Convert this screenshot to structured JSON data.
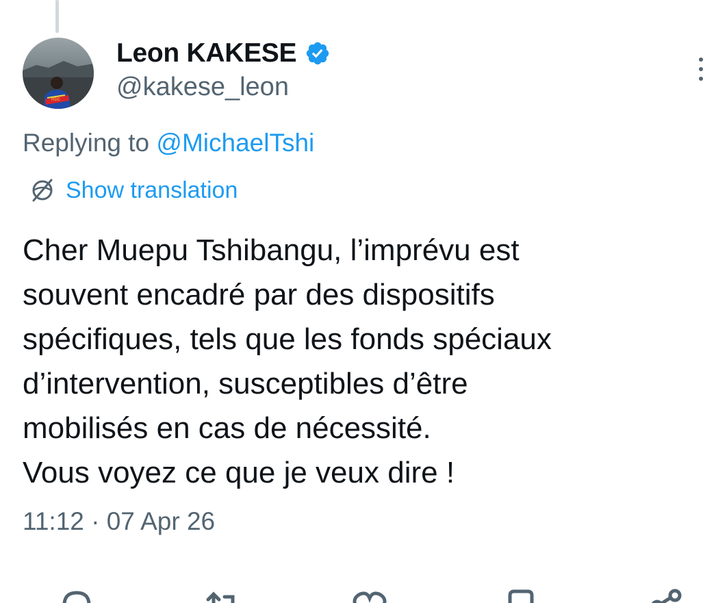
{
  "tweet": {
    "author": {
      "display_name": "Leon KAKESE",
      "handle": "@kakese_leon",
      "verified": true,
      "avatar_icon": "profile-photo-avatar"
    },
    "reply": {
      "prefix": "Replying to ",
      "mention": "@MichaelTshi"
    },
    "translation": {
      "label": "Show translation",
      "icon": "globe-icon"
    },
    "text": "Cher Muepu Tshibangu, l’imprévu est\nsouvent encadré par des dispositifs\nspécifiques, tels que les fonds spéciaux\nd’intervention, susceptibles d’être\nmobilisés en cas de nécessité.\nVous voyez ce que je veux dire !",
    "timestamp": "11:12 · 07 Apr 26"
  },
  "actions": [
    {
      "name": "reply",
      "icon": "reply-icon"
    },
    {
      "name": "retweet",
      "icon": "retweet-icon"
    },
    {
      "name": "like",
      "icon": "heart-icon"
    },
    {
      "name": "bookmark",
      "icon": "bookmark-icon"
    },
    {
      "name": "share",
      "icon": "share-icon"
    }
  ],
  "colors": {
    "link": "#1d9bf0",
    "secondary_text": "#536471",
    "primary_text": "#0f1419",
    "verified": "#1d9bf0"
  }
}
